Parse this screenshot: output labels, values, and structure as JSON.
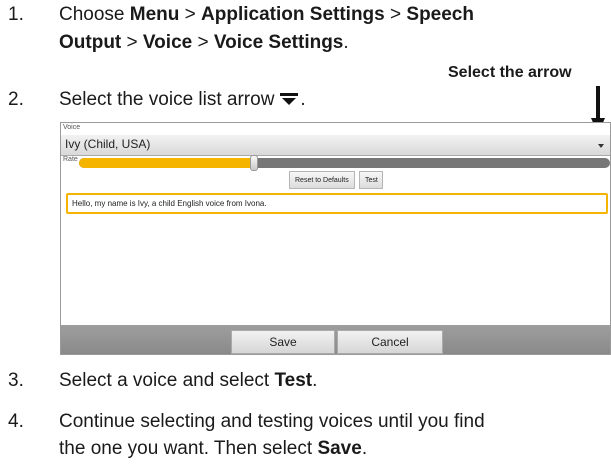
{
  "steps": [
    {
      "number": "1.",
      "line1_parts": [
        "Choose ",
        "Menu",
        " > ",
        "Application Settings",
        " > ",
        "Speech"
      ],
      "line2_parts": [
        "Output",
        " > ",
        "Voice",
        " > ",
        "Voice Settings",
        "."
      ]
    },
    {
      "number": "2.",
      "text": "Select the voice list arrow"
    },
    {
      "number": "3.",
      "text_before": "Select a voice and select ",
      "bold": "Test",
      "text_after": "."
    },
    {
      "number": "4.",
      "line1": "Continue selecting and testing voices until you find",
      "line2_before": "the one you want. Then select ",
      "line2_bold": "Save",
      "line2_after": "."
    }
  ],
  "step2_period": ".",
  "callout": {
    "label": "Select the arrow"
  },
  "panel": {
    "voice_caption": "Voice",
    "voice_value": "Ivy (Child, USA)",
    "rate_caption": "Rate",
    "rate_fraction": 0.33,
    "reset_button": "Reset to Defaults",
    "test_button": "Test",
    "speech_text": "Hello, my name is Ivy, a child English voice from Ivona.",
    "save_button": "Save",
    "cancel_button": "Cancel"
  },
  "colors": {
    "accent": "#f5b400",
    "bar": "#8f8f8f"
  },
  "icons": {
    "inline_arrow": "dropdown-arrow-icon",
    "callout_arrow": "down-arrow-icon"
  }
}
